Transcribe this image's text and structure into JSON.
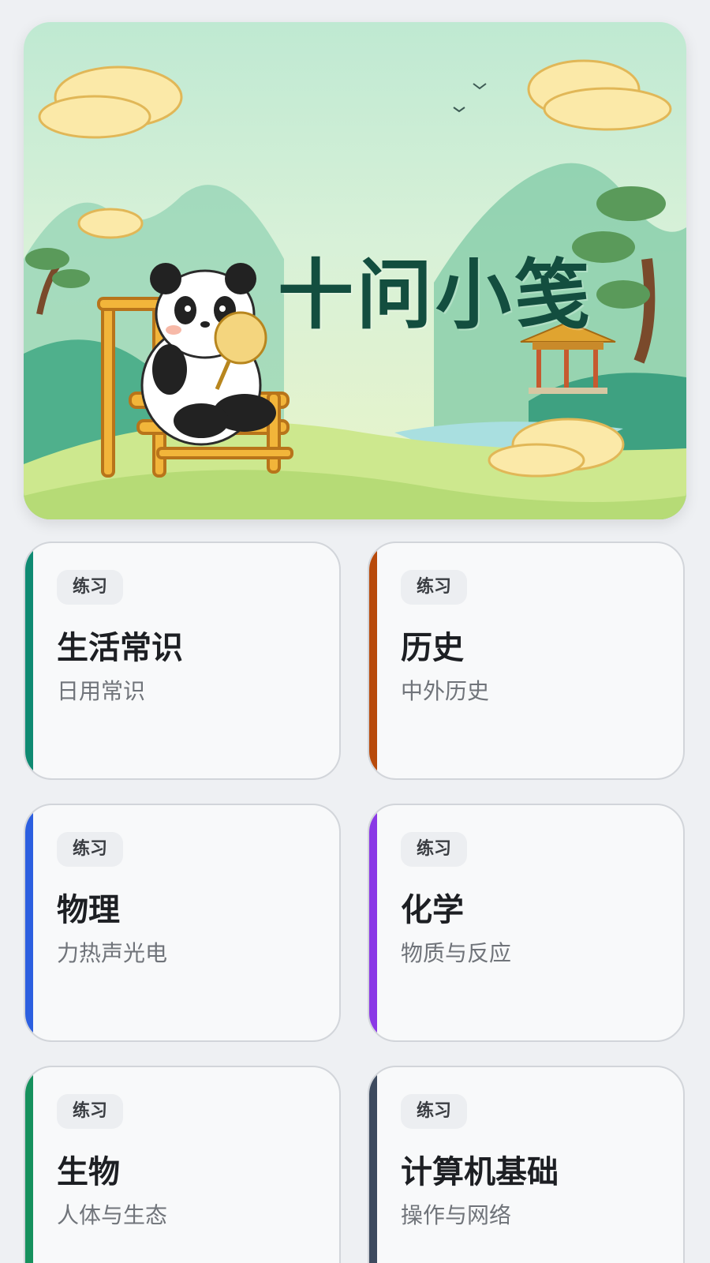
{
  "banner": {
    "title": "十问小笺"
  },
  "cards": [
    {
      "badge": "练习",
      "title": "生活常识",
      "subtitle": "日用常识",
      "accent": "#0f8a72"
    },
    {
      "badge": "练习",
      "title": "历史",
      "subtitle": "中外历史",
      "accent": "#b84a0b"
    },
    {
      "badge": "练习",
      "title": "物理",
      "subtitle": "力热声光电",
      "accent": "#2c5fe0"
    },
    {
      "badge": "练习",
      "title": "化学",
      "subtitle": "物质与反应",
      "accent": "#8a38e6"
    },
    {
      "badge": "练习",
      "title": "生物",
      "subtitle": "人体与生态",
      "accent": "#16915d"
    },
    {
      "badge": "练习",
      "title": "计算机基础",
      "subtitle": "操作与网络",
      "accent": "#3d4a5e"
    }
  ]
}
